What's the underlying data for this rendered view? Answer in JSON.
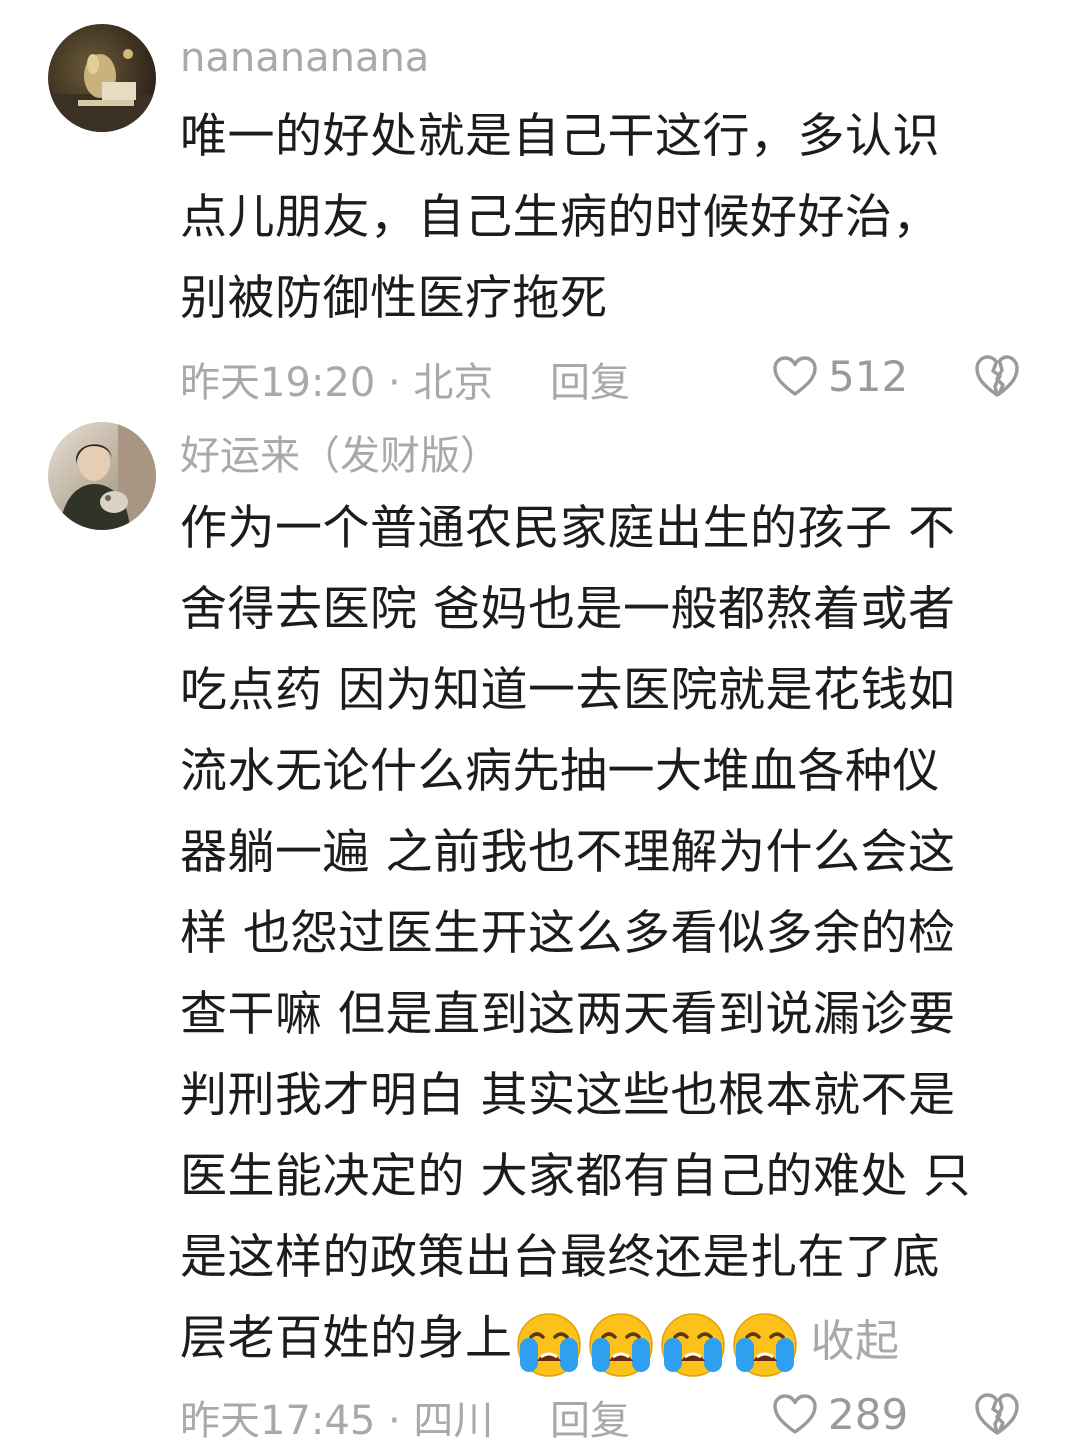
{
  "comments": [
    {
      "username": "nanananana",
      "lines": [
        "唯一的好处就是自己干这行，多认识",
        "点儿朋友，自己生病的时候好好治，",
        "别被防御性医疗拖死"
      ],
      "time_location": "昨天19:20 · 北京",
      "reply_label": "回复",
      "like_count": "512",
      "avatar": "avatar-dog-photo"
    },
    {
      "username": "好运来（发财版）",
      "lines": [
        "作为一个普通农民家庭出生的孩子 不",
        "舍得去医院 爸妈也是一般都熬着或者",
        "吃点药 因为知道一去医院就是花钱如",
        "流水无论什么病先抽一大堆血各种仪",
        "器躺一遍 之前我也不理解为什么会这",
        "样 也怨过医生开这么多看似多余的检",
        "查干嘛 但是直到这两天看到说漏诊要",
        "判刑我才明白 其实这些也根本就不是",
        "医生能决定的 大家都有自己的难处 只",
        "是这样的政策出台最终还是扎在了底"
      ],
      "last_line": "层老百姓的身上",
      "emoji_name": "crying-face-emoji",
      "emoji_count": 4,
      "collapse_label": "收起",
      "time_location": "昨天17:45 · 四川",
      "reply_label": "回复",
      "like_count": "289",
      "avatar": "avatar-person-photo"
    }
  ],
  "icons": {
    "like": "heart-outline-icon",
    "dislike": "broken-heart-icon"
  },
  "colors": {
    "text": "#1c1c1c",
    "muted": "#a9a9a9",
    "emoji_face": "#fcc21b",
    "emoji_tear": "#2f9ff0"
  }
}
